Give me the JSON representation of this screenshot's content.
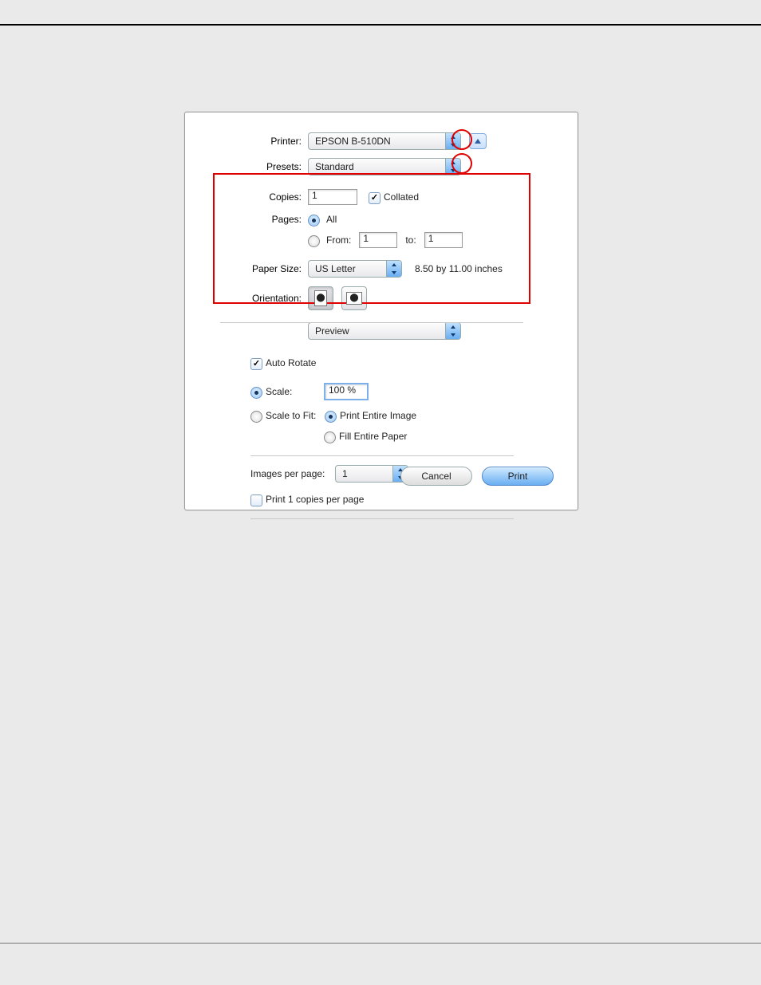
{
  "labels": {
    "printer": "Printer:",
    "presets": "Presets:",
    "copies": "Copies:",
    "pages": "Pages:",
    "paperSize": "Paper Size:",
    "orientation": "Orientation:",
    "collated": "Collated",
    "all": "All",
    "from": "From:",
    "to": "to:",
    "autoRotate": "Auto Rotate",
    "scale": "Scale:",
    "scaleToFit": "Scale to Fit:",
    "printEntireImage": "Print Entire Image",
    "fillEntirePaper": "Fill Entire Paper",
    "imagesPerPage": "Images per page:",
    "printCopiesPerPage": "Print 1 copies per page",
    "cancel": "Cancel",
    "print": "Print"
  },
  "values": {
    "printer": "EPSON B-510DN",
    "presets": "Standard",
    "copies": "1",
    "collated": true,
    "pagesMode": "all",
    "pageFrom": "1",
    "pageTo": "1",
    "paperSize": "US Letter",
    "paperDims": "8.50 by 11.00 inches",
    "orientation": "portrait",
    "appPane": "Preview",
    "autoRotate": true,
    "scaleMode": "scale",
    "scaleValue": "100 %",
    "fitMode": "entireImage",
    "imagesPerPage": "1",
    "printCopiesPerPage": false
  }
}
